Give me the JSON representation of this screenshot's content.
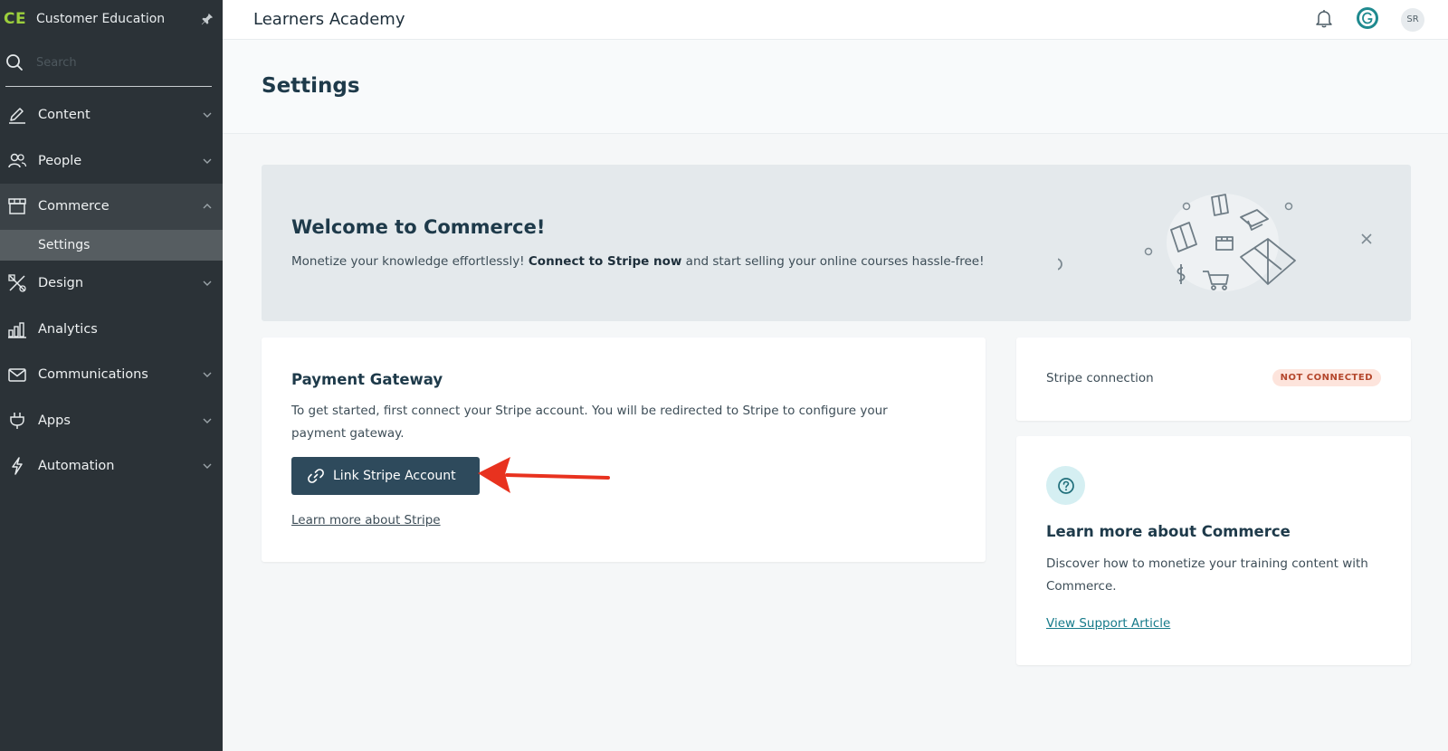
{
  "sidebar": {
    "brand_logo": "CE",
    "brand_name": "Customer Education",
    "search_placeholder": "Search",
    "items": [
      {
        "label": "Content",
        "icon": "pencil-icon"
      },
      {
        "label": "People",
        "icon": "people-icon"
      },
      {
        "label": "Commerce",
        "icon": "store-icon"
      },
      {
        "label": "Design",
        "icon": "design-tools-icon"
      },
      {
        "label": "Analytics",
        "icon": "bar-chart-icon"
      },
      {
        "label": "Communications",
        "icon": "envelope-icon"
      },
      {
        "label": "Apps",
        "icon": "plug-icon"
      },
      {
        "label": "Automation",
        "icon": "lightning-icon"
      }
    ],
    "sub_item": "Settings"
  },
  "topbar": {
    "title": "Learners Academy",
    "avatar_initials": "SR"
  },
  "page": {
    "title": "Settings"
  },
  "banner": {
    "title": "Welcome to Commerce!",
    "text_before": "Monetize your knowledge effortlessly! ",
    "text_bold": "Connect to Stripe now",
    "text_after": " and start selling your online courses hassle-free!"
  },
  "payment": {
    "title": "Payment Gateway",
    "description": "To get started, first connect your Stripe account. You will be redirected to Stripe to configure your payment gateway.",
    "button_label": "Link Stripe Account",
    "learn_link": "Learn more about Stripe"
  },
  "stripe": {
    "label": "Stripe connection",
    "status": "NOT CONNECTED"
  },
  "learn": {
    "title": "Learn more about Commerce",
    "description": "Discover how to monetize your training content with Commerce.",
    "link": "View Support Article"
  },
  "colors": {
    "sidebar_bg": "#2b3237",
    "brand_accent": "#9ccf3c",
    "primary_button": "#2e4a5c",
    "badge_bg": "#fde4dc",
    "badge_text": "#b4472c",
    "link_teal": "#167a8a",
    "arrow_red": "#e8321f"
  }
}
